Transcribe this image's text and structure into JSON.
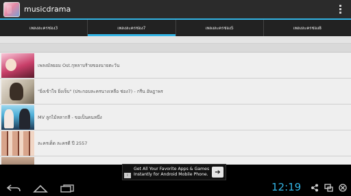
{
  "app": {
    "title": "musicdrama"
  },
  "tabs": [
    {
      "label": "เพลงละครช่อง3"
    },
    {
      "label": "เพลงละครช่อง7"
    },
    {
      "label": "เพลงละครช่อง5"
    },
    {
      "label": "เพลงละครช่อง8"
    }
  ],
  "active_tab": 1,
  "list": [
    {
      "title": "เพลงมัลยอม Ost.กุหลาบร้ายของนายตะวัน",
      "thumb": "thumb-1"
    },
    {
      "title": "\"ยิ่งเข้าใจ ยิ่งเจ็บ\" (ประกอบละครนางเหลือ ช่อง7) - กรีน อัษฎาพร",
      "thumb": "thumb-2"
    },
    {
      "title": "MV ลูกไม้หลากสี - ขอเป็นคนหนึ่ง",
      "thumb": "thumb-3"
    },
    {
      "title": "ละครเด็ด ละครดี ปี 2557",
      "thumb": "thumb-4"
    },
    {
      "title": "",
      "thumb": "thumb-5"
    }
  ],
  "ad": {
    "line1": "Get All Your Favorite Apps & Games",
    "line2": "Instantly for Android Mobile Phone.",
    "badge": "i",
    "arrow": "➔"
  },
  "status": {
    "time": "12:19"
  },
  "icons": {
    "back": "back-icon",
    "home": "home-icon",
    "recents": "recents-icon",
    "share": "share-icon",
    "screen": "screen-icon",
    "power": "power-icon"
  },
  "colors": {
    "accent": "#33b5e5",
    "actionbar": "#2b2b2b",
    "list_bg": "#efefef"
  }
}
